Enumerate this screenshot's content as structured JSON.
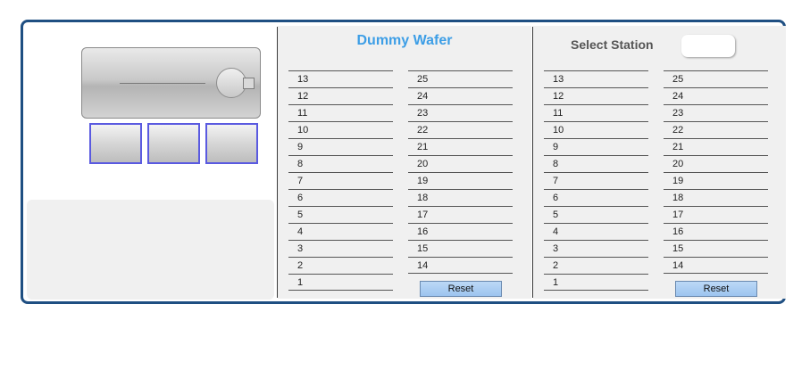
{
  "dummy_wafer": {
    "title": "Dummy Wafer",
    "left_slots": [
      "13",
      "12",
      "11",
      "10",
      "9",
      "8",
      "7",
      "6",
      "5",
      "4",
      "3",
      "2",
      "1"
    ],
    "right_slots": [
      "25",
      "24",
      "23",
      "22",
      "21",
      "20",
      "19",
      "18",
      "17",
      "16",
      "15",
      "14"
    ],
    "reset_label": "Reset"
  },
  "station": {
    "label": "Select  Station",
    "left_slots": [
      "13",
      "12",
      "11",
      "10",
      "9",
      "8",
      "7",
      "6",
      "5",
      "4",
      "3",
      "2",
      "1"
    ],
    "right_slots": [
      "25",
      "24",
      "23",
      "22",
      "21",
      "20",
      "19",
      "18",
      "17",
      "16",
      "15",
      "14"
    ],
    "reset_label": "Reset"
  },
  "colors": {
    "frame": "#1f4f82",
    "title": "#3d9ee6",
    "slot_border": "#5a5ae0",
    "reset_button": "#a9cdf2"
  }
}
